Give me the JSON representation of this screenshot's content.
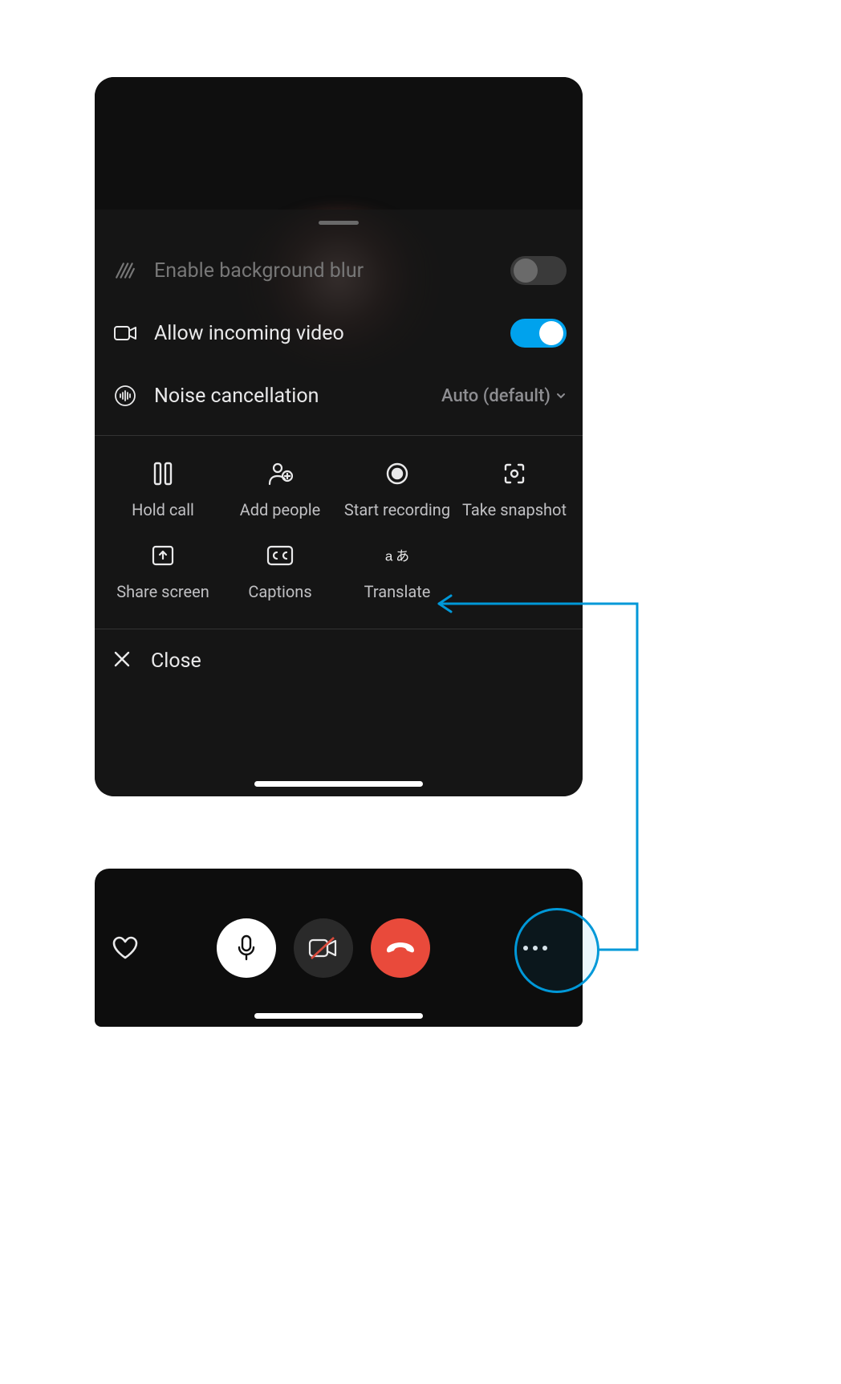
{
  "sheet": {
    "options": {
      "blur": {
        "label": "Enable background blur"
      },
      "video": {
        "label": "Allow incoming video"
      },
      "noise": {
        "label": "Noise cancellation",
        "value": "Auto (default)"
      }
    },
    "actions": {
      "hold": "Hold call",
      "add": "Add people",
      "record": "Start recording",
      "snapshot": "Take snapshot",
      "share": "Share screen",
      "captions": "Captions",
      "translate": "Translate"
    },
    "close": "Close"
  }
}
